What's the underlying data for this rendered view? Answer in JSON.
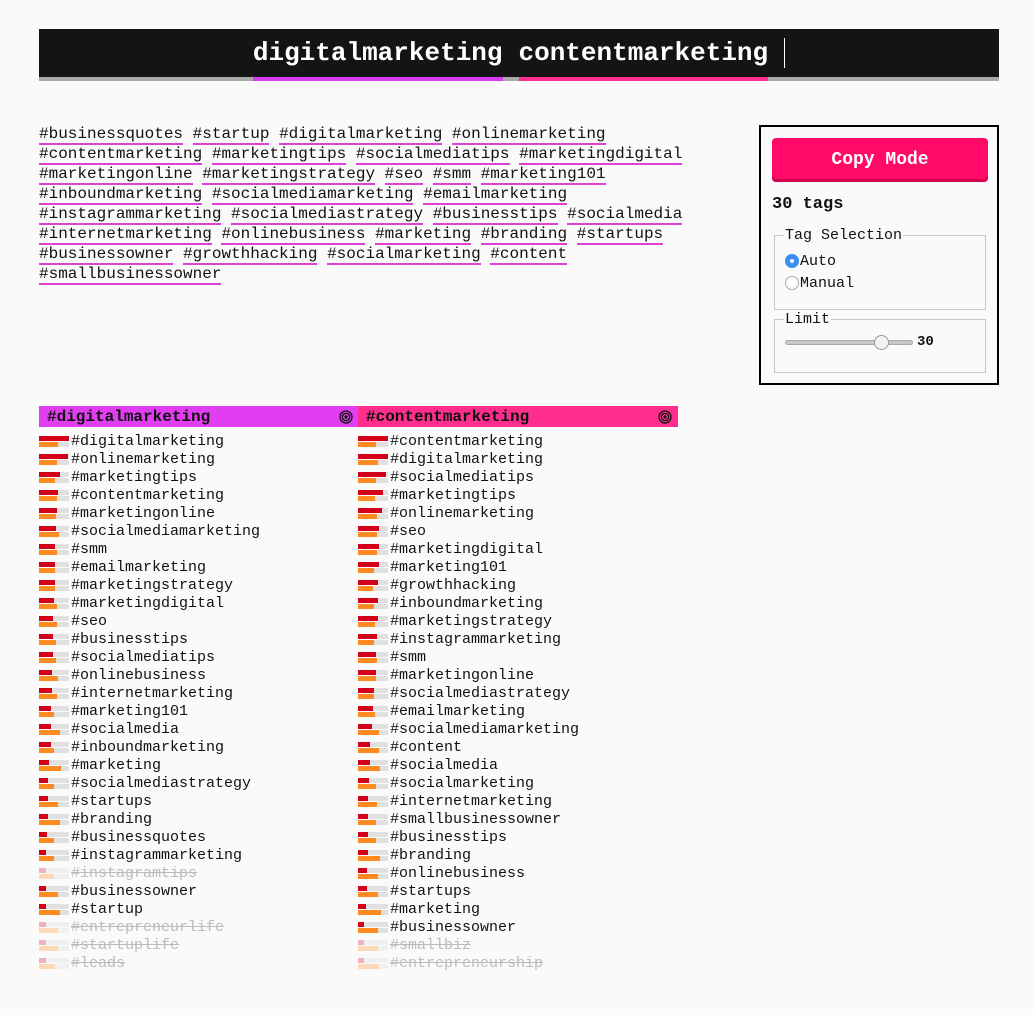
{
  "search": {
    "terms": [
      "digitalmarketing",
      "contentmarketing"
    ],
    "term_colors": [
      "#d63cf0",
      "#ff2e8c"
    ]
  },
  "tag_cloud": [
    "#businessquotes",
    "#startup",
    "#digitalmarketing",
    "#onlinemarketing",
    "#contentmarketing",
    "#marketingtips",
    "#socialmediatips",
    "#marketingdigital",
    "#marketingonline",
    "#marketingstrategy",
    "#seo",
    "#smm",
    "#marketing101",
    "#inboundmarketing",
    "#socialmediamarketing",
    "#emailmarketing",
    "#instagrammarketing",
    "#socialmediastrategy",
    "#businesstips",
    "#socialmedia",
    "#internetmarketing",
    "#onlinebusiness",
    "#marketing",
    "#branding",
    "#startups",
    "#businessowner",
    "#growthhacking",
    "#socialmarketing",
    "#content",
    "#smallbusinessowner"
  ],
  "panel": {
    "copy_button": "Copy Mode",
    "count_label": "30 tags",
    "selection_legend": "Tag Selection",
    "options": [
      "Auto",
      "Manual"
    ],
    "selected_option": "Auto",
    "limit_legend": "Limit",
    "limit_value": "30",
    "limit_fraction": 0.75
  },
  "columns": [
    {
      "title": "#digitalmarketing",
      "color": "#e03ef0",
      "rows": [
        {
          "tag": "#digitalmarketing",
          "a": 1.0,
          "b": 0.63,
          "on": true
        },
        {
          "tag": "#onlinemarketing",
          "a": 0.97,
          "b": 0.6,
          "on": true
        },
        {
          "tag": "#marketingtips",
          "a": 0.7,
          "b": 0.53,
          "on": true
        },
        {
          "tag": "#contentmarketing",
          "a": 0.63,
          "b": 0.6,
          "on": true
        },
        {
          "tag": "#marketingonline",
          "a": 0.6,
          "b": 0.57,
          "on": true
        },
        {
          "tag": "#socialmediamarketing",
          "a": 0.57,
          "b": 0.67,
          "on": true
        },
        {
          "tag": "#smm",
          "a": 0.53,
          "b": 0.6,
          "on": true
        },
        {
          "tag": "#emailmarketing",
          "a": 0.53,
          "b": 0.53,
          "on": true
        },
        {
          "tag": "#marketingstrategy",
          "a": 0.53,
          "b": 0.53,
          "on": true
        },
        {
          "tag": "#marketingdigital",
          "a": 0.5,
          "b": 0.6,
          "on": true
        },
        {
          "tag": "#seo",
          "a": 0.47,
          "b": 0.6,
          "on": true
        },
        {
          "tag": "#businesstips",
          "a": 0.47,
          "b": 0.57,
          "on": true
        },
        {
          "tag": "#socialmediatips",
          "a": 0.47,
          "b": 0.57,
          "on": true
        },
        {
          "tag": "#onlinebusiness",
          "a": 0.43,
          "b": 0.63,
          "on": true
        },
        {
          "tag": "#internetmarketing",
          "a": 0.43,
          "b": 0.6,
          "on": true
        },
        {
          "tag": "#marketing101",
          "a": 0.4,
          "b": 0.5,
          "on": true
        },
        {
          "tag": "#socialmedia",
          "a": 0.4,
          "b": 0.7,
          "on": true
        },
        {
          "tag": "#inboundmarketing",
          "a": 0.4,
          "b": 0.5,
          "on": true
        },
        {
          "tag": "#marketing",
          "a": 0.33,
          "b": 0.73,
          "on": true
        },
        {
          "tag": "#socialmediastrategy",
          "a": 0.3,
          "b": 0.5,
          "on": true
        },
        {
          "tag": "#startups",
          "a": 0.3,
          "b": 0.63,
          "on": true
        },
        {
          "tag": "#branding",
          "a": 0.3,
          "b": 0.7,
          "on": true
        },
        {
          "tag": "#businessquotes",
          "a": 0.27,
          "b": 0.5,
          "on": true
        },
        {
          "tag": "#instagrammarketing",
          "a": 0.23,
          "b": 0.5,
          "on": true
        },
        {
          "tag": "#instagramtips",
          "a": 0.23,
          "b": 0.5,
          "on": false
        },
        {
          "tag": "#businessowner",
          "a": 0.23,
          "b": 0.63,
          "on": true
        },
        {
          "tag": "#startup",
          "a": 0.23,
          "b": 0.7,
          "on": true
        },
        {
          "tag": "#entrepreneurlife",
          "a": 0.23,
          "b": 0.63,
          "on": false
        },
        {
          "tag": "#startuplife",
          "a": 0.23,
          "b": 0.63,
          "on": false
        },
        {
          "tag": "#leads",
          "a": 0.23,
          "b": 0.53,
          "on": false
        }
      ]
    },
    {
      "title": "#contentmarketing",
      "color": "#ff2e8c",
      "rows": [
        {
          "tag": "#contentmarketing",
          "a": 1.0,
          "b": 0.6,
          "on": true
        },
        {
          "tag": "#digitalmarketing",
          "a": 1.0,
          "b": 0.67,
          "on": true
        },
        {
          "tag": "#socialmediatips",
          "a": 0.93,
          "b": 0.6,
          "on": true
        },
        {
          "tag": "#marketingtips",
          "a": 0.83,
          "b": 0.57,
          "on": true
        },
        {
          "tag": "#onlinemarketing",
          "a": 0.8,
          "b": 0.63,
          "on": true
        },
        {
          "tag": "#seo",
          "a": 0.7,
          "b": 0.63,
          "on": true
        },
        {
          "tag": "#marketingdigital",
          "a": 0.7,
          "b": 0.63,
          "on": true
        },
        {
          "tag": "#marketing101",
          "a": 0.7,
          "b": 0.53,
          "on": true
        },
        {
          "tag": "#growthhacking",
          "a": 0.67,
          "b": 0.5,
          "on": true
        },
        {
          "tag": "#inboundmarketing",
          "a": 0.67,
          "b": 0.53,
          "on": true
        },
        {
          "tag": "#marketingstrategy",
          "a": 0.67,
          "b": 0.57,
          "on": true
        },
        {
          "tag": "#instagrammarketing",
          "a": 0.63,
          "b": 0.53,
          "on": true
        },
        {
          "tag": "#smm",
          "a": 0.6,
          "b": 0.63,
          "on": true
        },
        {
          "tag": "#marketingonline",
          "a": 0.6,
          "b": 0.6,
          "on": true
        },
        {
          "tag": "#socialmediastrategy",
          "a": 0.53,
          "b": 0.53,
          "on": true
        },
        {
          "tag": "#emailmarketing",
          "a": 0.5,
          "b": 0.57,
          "on": true
        },
        {
          "tag": "#socialmediamarketing",
          "a": 0.47,
          "b": 0.7,
          "on": true
        },
        {
          "tag": "#content",
          "a": 0.4,
          "b": 0.7,
          "on": true
        },
        {
          "tag": "#socialmedia",
          "a": 0.4,
          "b": 0.73,
          "on": true
        },
        {
          "tag": "#socialmarketing",
          "a": 0.37,
          "b": 0.6,
          "on": true
        },
        {
          "tag": "#internetmarketing",
          "a": 0.33,
          "b": 0.63,
          "on": true
        },
        {
          "tag": "#smallbusinessowner",
          "a": 0.33,
          "b": 0.6,
          "on": true
        },
        {
          "tag": "#businesstips",
          "a": 0.33,
          "b": 0.6,
          "on": true
        },
        {
          "tag": "#branding",
          "a": 0.33,
          "b": 0.73,
          "on": true
        },
        {
          "tag": "#onlinebusiness",
          "a": 0.3,
          "b": 0.67,
          "on": true
        },
        {
          "tag": "#startups",
          "a": 0.3,
          "b": 0.67,
          "on": true
        },
        {
          "tag": "#marketing",
          "a": 0.27,
          "b": 0.77,
          "on": true
        },
        {
          "tag": "#businessowner",
          "a": 0.2,
          "b": 0.67,
          "on": true
        },
        {
          "tag": "#smallbiz",
          "a": 0.2,
          "b": 0.67,
          "on": false
        },
        {
          "tag": "#entrepreneurship",
          "a": 0.2,
          "b": 0.7,
          "on": false
        }
      ]
    }
  ]
}
